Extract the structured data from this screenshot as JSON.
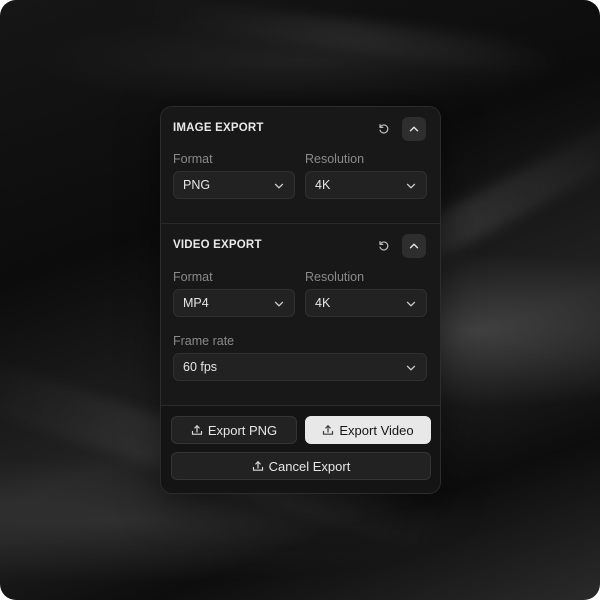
{
  "image_export": {
    "title": "IMAGE EXPORT",
    "format_label": "Format",
    "format_value": "PNG",
    "resolution_label": "Resolution",
    "resolution_value": "4K"
  },
  "video_export": {
    "title": "VIDEO EXPORT",
    "format_label": "Format",
    "format_value": "MP4",
    "resolution_label": "Resolution",
    "resolution_value": "4K",
    "frame_rate_label": "Frame rate",
    "frame_rate_value": "60 fps"
  },
  "actions": {
    "export_png": "Export PNG",
    "export_video": "Export Video",
    "cancel_export": "Cancel Export"
  },
  "icons": {
    "reset": "reset-icon",
    "collapse": "chevron-up-icon",
    "dropdown": "chevron-down-icon",
    "export": "upload-icon"
  },
  "colors": {
    "panel_bg": "#141414",
    "primary_button_bg": "#e8e8e8",
    "secondary_button_bg": "#222222",
    "label_text": "#8a8a8a"
  }
}
